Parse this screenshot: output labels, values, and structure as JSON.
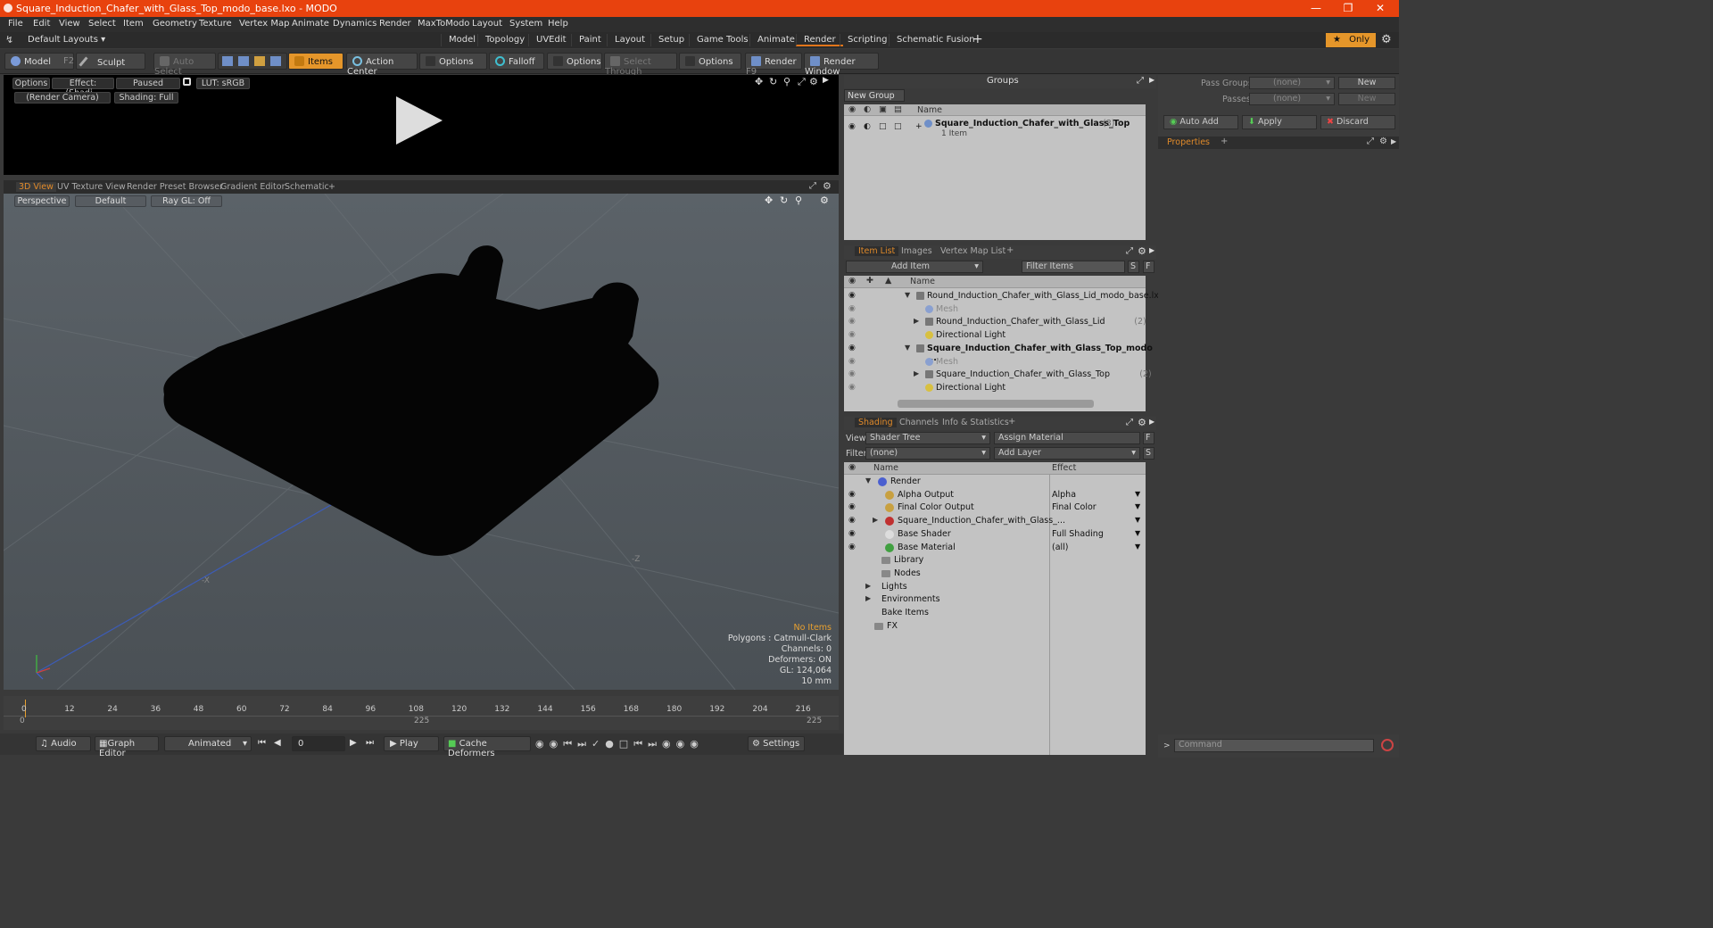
{
  "window": {
    "title": "Square_Induction_Chafer_with_Glass_Top_modo_base.lxo - MODO"
  },
  "menu": [
    "File",
    "Edit",
    "View",
    "Select",
    "Item",
    "Geometry",
    "Texture",
    "Vertex Map",
    "Animate",
    "Dynamics",
    "Render",
    "MaxToModo",
    "Layout",
    "System",
    "Help"
  ],
  "layouts": {
    "dropdown": "Default Layouts",
    "tabs": [
      "Model",
      "Topology",
      "UVEdit",
      "Paint",
      "Layout",
      "Setup",
      "Game Tools",
      "Animate",
      "Render",
      "Scripting",
      "Schematic Fusion"
    ],
    "active": "Render",
    "only_label": "Only"
  },
  "toolbar": {
    "model": "Model",
    "model_key": "F2",
    "sculpt": "Sculpt",
    "auto_select": "Auto Select",
    "items": "Items",
    "action_center": "Action Center",
    "options1": "Options",
    "falloff": "Falloff",
    "options2": "Options",
    "select_through": "Select Through",
    "options3": "Options",
    "render": "Render",
    "render_key": "F9",
    "render_window": "Render Window"
  },
  "render_view": {
    "options": "Options",
    "effect": "Effect: (Shadi...",
    "paused": "Paused",
    "lut": "LUT: sRGB",
    "camera": "(Render Camera)",
    "shading": "Shading: Full"
  },
  "view_tabs": [
    "3D View",
    "UV Texture View",
    "Render Preset Browser",
    "Gradient Editor",
    "Schematic"
  ],
  "viewport": {
    "perspective": "Perspective",
    "default": "Default",
    "raygl": "Ray GL: Off",
    "no_items": "No Items",
    "stats": [
      "Polygons : Catmull-Clark",
      "Channels: 0",
      "Deformers: ON",
      "GL: 124,064",
      "10 mm"
    ]
  },
  "timeline": {
    "ticks": [
      "0",
      "12",
      "24",
      "36",
      "48",
      "60",
      "72",
      "84",
      "96",
      "108",
      "120",
      "132",
      "144",
      "156",
      "168",
      "180",
      "192",
      "204",
      "216"
    ],
    "start": "0",
    "mid": "225",
    "end": "225"
  },
  "bottom": {
    "audio": "Audio",
    "graph_editor": "Graph Editor",
    "animated": "Animated",
    "frame": "0",
    "play": "Play",
    "cache": "Cache Deformers",
    "settings": "Settings"
  },
  "groups": {
    "title": "Groups",
    "new_group": "New Group",
    "col_name": "Name",
    "item_name": "Square_Induction_Chafer_with_Glass_Top",
    "item_count": "(3) :",
    "item_sub": "1 Item"
  },
  "item_list": {
    "tabs": [
      "Item List",
      "Images",
      "Vertex Map List"
    ],
    "add_item": "Add Item",
    "filter": "Filter Items",
    "col_name": "Name",
    "rows": [
      {
        "label": "Round_Induction_Chafer_with_Glass_Lid_modo_base.lxo",
        "suffix": "",
        "indent": 0,
        "bold": false,
        "dim": false
      },
      {
        "label": "Mesh",
        "suffix": "",
        "indent": 1,
        "bold": false,
        "dim": true
      },
      {
        "label": "Round_Induction_Chafer_with_Glass_Lid",
        "suffix": "(2)",
        "indent": 1,
        "bold": false,
        "dim": false
      },
      {
        "label": "Directional Light",
        "suffix": "",
        "indent": 1,
        "bold": false,
        "dim": false
      },
      {
        "label": "Square_Induction_Chafer_with_Glass_Top_modo ...",
        "suffix": "",
        "indent": 0,
        "bold": true,
        "dim": false
      },
      {
        "label": "Mesh",
        "suffix": "",
        "indent": 1,
        "bold": false,
        "dim": true
      },
      {
        "label": "Square_Induction_Chafer_with_Glass_Top",
        "suffix": "(2)",
        "indent": 1,
        "bold": false,
        "dim": false
      },
      {
        "label": "Directional Light",
        "suffix": "",
        "indent": 1,
        "bold": false,
        "dim": false
      }
    ]
  },
  "shading": {
    "tabs": [
      "Shading",
      "Channels",
      "Info & Statistics"
    ],
    "view_label": "View",
    "view_value": "Shader Tree",
    "assign": "Assign Material",
    "filter_label": "Filter",
    "filter_value": "(none)",
    "add_layer": "Add Layer",
    "col_name": "Name",
    "col_effect": "Effect",
    "rows": [
      {
        "label": "Render",
        "effect": "",
        "indent": 0,
        "icon": "#4a5fd0"
      },
      {
        "label": "Alpha Output",
        "effect": "Alpha",
        "indent": 1,
        "icon": "#c8a040"
      },
      {
        "label": "Final Color Output",
        "effect": "Final Color",
        "indent": 1,
        "icon": "#c8a040"
      },
      {
        "label": "Square_Induction_Chafer_with_Glass_...",
        "effect": "",
        "indent": 1,
        "icon": "#c03030"
      },
      {
        "label": "Base Shader",
        "effect": "Full Shading",
        "indent": 1,
        "icon": "#ddd"
      },
      {
        "label": "Base Material",
        "effect": "(all)",
        "indent": 1,
        "icon": "#40a040"
      },
      {
        "label": "Library",
        "effect": "",
        "indent": 1,
        "icon": ""
      },
      {
        "label": "Nodes",
        "effect": "",
        "indent": 1,
        "icon": ""
      },
      {
        "label": "Lights",
        "effect": "",
        "indent": 0,
        "icon": ""
      },
      {
        "label": "Environments",
        "effect": "",
        "indent": 0,
        "icon": ""
      },
      {
        "label": "Bake Items",
        "effect": "",
        "indent": 0,
        "icon": ""
      },
      {
        "label": "FX",
        "effect": "",
        "indent": 0,
        "icon": ""
      }
    ]
  },
  "right": {
    "pass_groups": "Pass Groups",
    "passes": "Passes",
    "none1": "(none)",
    "none2": "(none)",
    "new1": "New",
    "new2": "New",
    "auto_add": "Auto Add",
    "apply": "Apply",
    "discard": "Discard",
    "properties": "Properties",
    "command": "Command"
  }
}
